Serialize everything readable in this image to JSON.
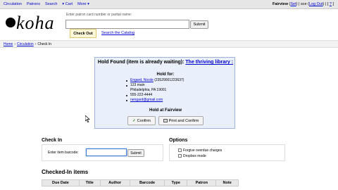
{
  "topnav": {
    "items": [
      "Circulation",
      "Patrons",
      "Search",
      "Cart",
      "More"
    ],
    "branch": "Fairview",
    "set_link": "Set",
    "user": "sce",
    "logout_link": "Log Out",
    "help_link": "?"
  },
  "logo": {
    "text": "koha"
  },
  "search": {
    "label": "Enter patron card number or partial name:",
    "value": "",
    "submit_label": "Submit"
  },
  "tabs": {
    "checkout": "Check Out",
    "catalog": "Search the Catalog"
  },
  "breadcrumb": [
    "Home",
    "Circulation",
    "Check In"
  ],
  "hold": {
    "title_prefix": "Hold Found (item is already waiting):",
    "title_link": "The thriving library :",
    "hold_for_label": "Hold for:",
    "patron_name": "Engard, Nicole",
    "patron_card": "(23529001223637)",
    "address1": "123 main",
    "address2": "Philadelphia, PA 19001",
    "phone": "555-222-4444",
    "email": "nengard@gmail.com",
    "hold_at": "Hold at Fairview",
    "confirm_label": "Confirm",
    "print_confirm_label": "Print and Confirm"
  },
  "checkin": {
    "title": "Check In",
    "barcode_label": "Enter item barcode:",
    "barcode_value": "",
    "submit_label": "Submit"
  },
  "options": {
    "title": "Options",
    "items": [
      "Forgive overdue charges",
      "Dropbox mode"
    ]
  },
  "checked_in": {
    "title": "Checked-In items",
    "columns": [
      "Due Date",
      "Title",
      "Author",
      "Barcode",
      "Type",
      "Patron",
      "Note"
    ]
  },
  "colors": {
    "link": "#0000cc",
    "hold_bg": "#eaf0fb",
    "hold_border": "#9fb4d8",
    "tab_active": "#fff8d8"
  },
  "icons": [
    "cart-icon",
    "caret-down-icon",
    "check-icon",
    "printer-icon",
    "mouse-cursor-icon"
  ]
}
